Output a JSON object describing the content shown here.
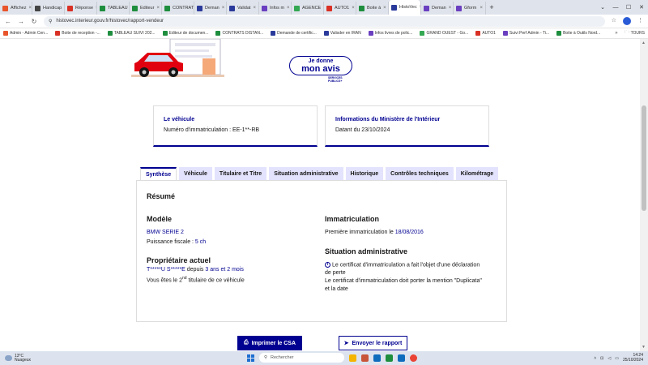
{
  "browser": {
    "tabs": [
      {
        "label": "Affichez",
        "color": "#e8542b"
      },
      {
        "label": "Handicap",
        "color": "#444"
      },
      {
        "label": "Réponse",
        "color": "#d93025"
      },
      {
        "label": "TABLEAU",
        "color": "#1e8e3e"
      },
      {
        "label": "Editeur",
        "color": "#1e8e3e"
      },
      {
        "label": "CONTRAT",
        "color": "#1e8e3e"
      },
      {
        "label": "Deman",
        "color": "#2a3a9a"
      },
      {
        "label": "Validat",
        "color": "#2a3a9a"
      },
      {
        "label": "Infos m",
        "color": "#6a3fc0"
      },
      {
        "label": "AGENCE",
        "color": "#34a853"
      },
      {
        "label": "AUTO1",
        "color": "#d93025"
      },
      {
        "label": "Boite à",
        "color": "#1e8e3e"
      },
      {
        "label": "HistoVec",
        "color": "#2a3a9a",
        "active": true
      },
      {
        "label": "Deman",
        "color": "#6a3fc0"
      },
      {
        "label": "Gform",
        "color": "#6a3fc0"
      }
    ],
    "new_tab": "+",
    "url": "histovec.interieur.gouv.fr/histovec/rapport-vendeur",
    "bookmarks": [
      {
        "label": "Admin - Admin Cen...",
        "color": "#e8542b"
      },
      {
        "label": "Boite de reception -...",
        "color": "#d93025"
      },
      {
        "label": "TABLEAU SUIVI 202...",
        "color": "#1e8e3e"
      },
      {
        "label": "Editeur de documen...",
        "color": "#1e8e3e"
      },
      {
        "label": "CONTRATS DISTAN...",
        "color": "#1e8e3e"
      },
      {
        "label": "Demande de certific...",
        "color": "#2a3a9a"
      },
      {
        "label": "Valisder en IRAN",
        "color": "#2a3a9a"
      },
      {
        "label": "Infos livres de polic...",
        "color": "#6a3fc0"
      },
      {
        "label": "GRAND OUEST - Go...",
        "color": "#34a853"
      },
      {
        "label": "AUTO1",
        "color": "#d93025"
      },
      {
        "label": "Suivi Perf Admin - Ti...",
        "color": "#6a3fc0"
      },
      {
        "label": "Boite à Outils Nord...",
        "color": "#1e8e3e"
      }
    ],
    "bookmarks_more": "»",
    "bookmarks_folder": "TOURS"
  },
  "hero": {
    "avis_line1": "Je donne",
    "avis_line2": "mon avis",
    "sp_line1": "SERVICES",
    "sp_line2": "PUBLICS+"
  },
  "cards": {
    "vehicle_title": "Le véhicule",
    "vehicle_text": "Numéro d'immatriculation : EE-1**-RB",
    "ministry_title": "Informations du Ministère de l'Intérieur",
    "ministry_text": "Datant du 23/10/2024"
  },
  "tabs": [
    "Synthèse",
    "Véhicule",
    "Titulaire et Titre",
    "Situation administrative",
    "Historique",
    "Contrôles techniques",
    "Kilométrage"
  ],
  "summary": {
    "title": "Résumé",
    "model_title": "Modèle",
    "model_name": "BMW SERIE 2",
    "power_label": "Puissance fiscale : ",
    "power_value": "5 ch",
    "owner_title": "Propriétaire actuel",
    "owner_name": "T*****U S*****E",
    "owner_since_label": " depuis ",
    "owner_since_value": "3 ans et 2 mois",
    "owner_rank_pre": "Vous êtes le 2",
    "owner_rank_sup": "nd",
    "owner_rank_post": " titulaire de ce véhicule",
    "immat_title": "Immatriculation",
    "immat_label": "Première immatriculation le ",
    "immat_date": "18/08/2016",
    "admin_title": "Situation administrative",
    "admin_line1": "Le certificat d'immatriculation a fait l'objet d'une déclaration",
    "admin_line2": "de perte",
    "admin_line3": "Le certificat d'immatriculation doit porter la mention \"Duplicata\"",
    "admin_line4": "et la date"
  },
  "actions": {
    "print_label": "Imprimer le CSA",
    "send_label": "Envoyer le rapport"
  },
  "taskbar": {
    "temp": "13°C",
    "weather": "Nuageux",
    "search_placeholder": "Rechercher",
    "time": "14:24",
    "date": "25/10/2024"
  },
  "colors": {
    "primary": "#000091",
    "tab_bg": "#e3e3fd"
  }
}
